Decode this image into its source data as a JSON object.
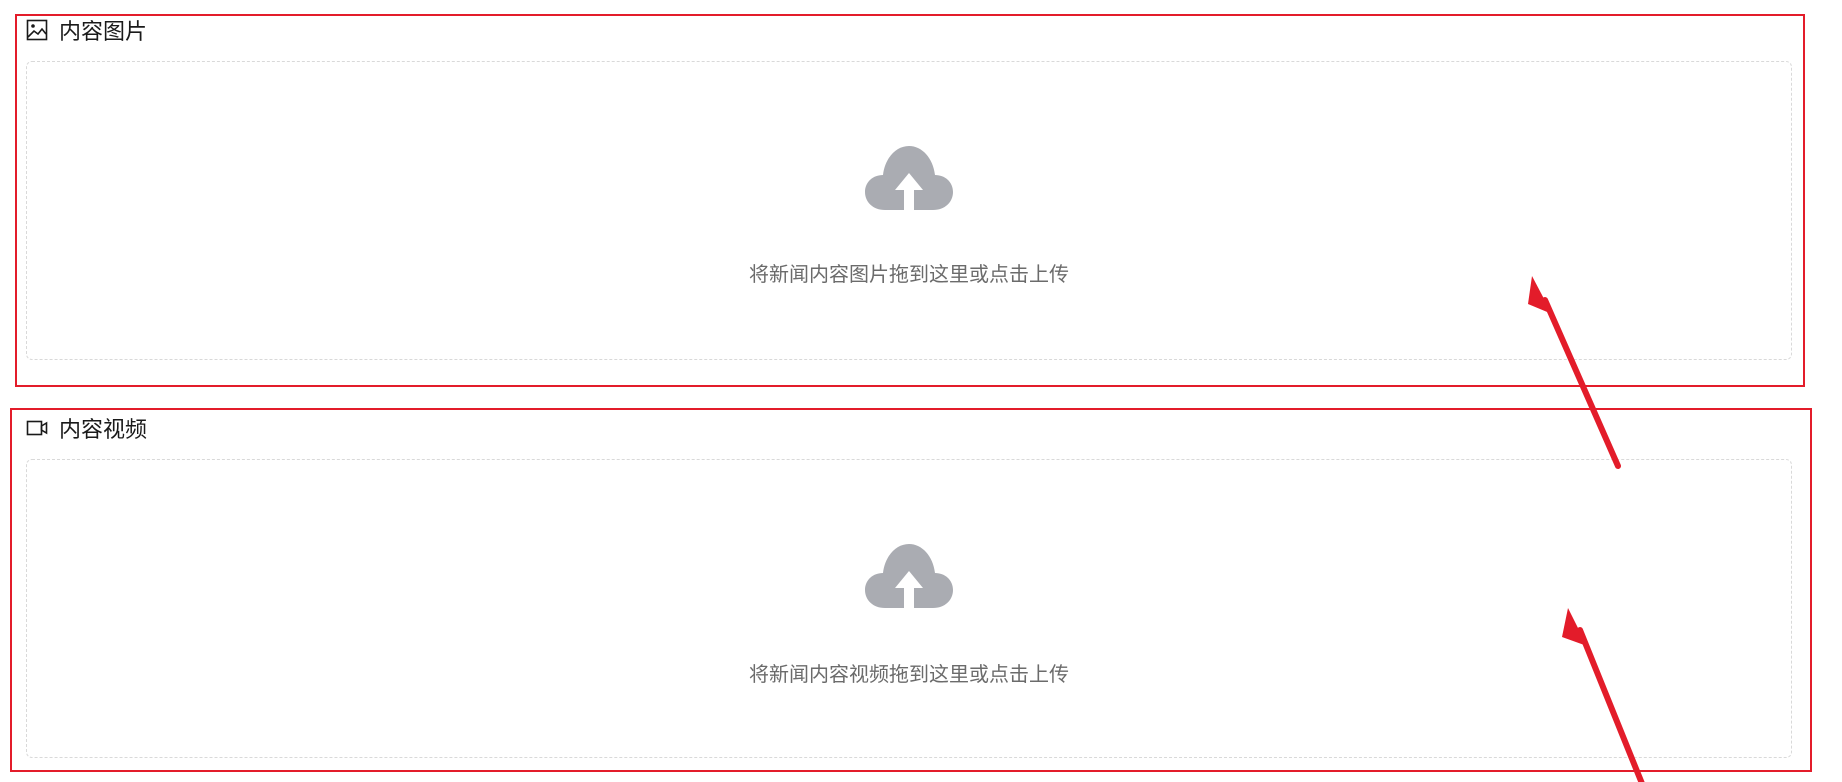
{
  "image_section": {
    "title": "内容图片",
    "icon": "image-icon",
    "upload_icon": "cloud-upload-icon",
    "hint": "将新闻内容图片拖到这里或点击上传"
  },
  "video_section": {
    "title": "内容视频",
    "icon": "video-icon",
    "upload_icon": "cloud-upload-icon",
    "hint": "将新闻内容视频拖到这里或点击上传"
  },
  "colors": {
    "annotation": "#e31c2a",
    "upload_icon": "#aaacb2",
    "hint_text": "#6b6b6b",
    "dropzone_border": "#d9d9d9"
  }
}
